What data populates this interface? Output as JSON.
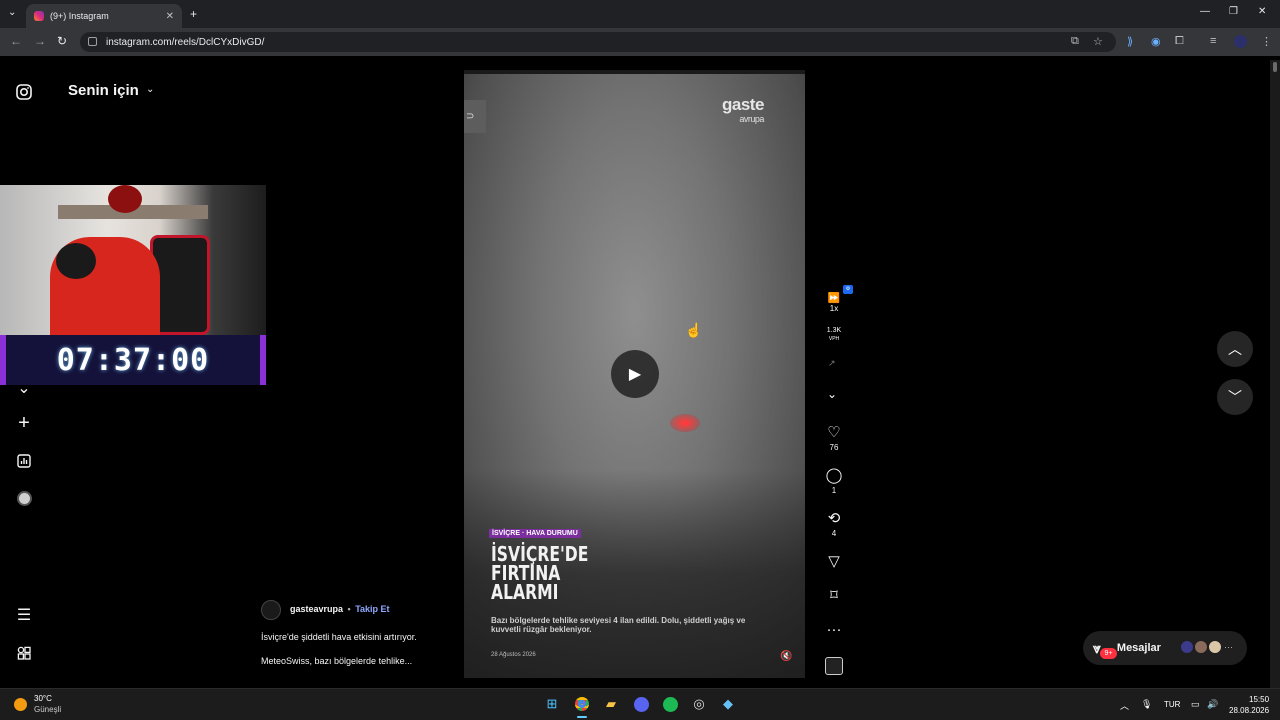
{
  "browser": {
    "tab_title": "(9+) Instagram",
    "url": "instagram.com/reels/DclCYxDivGD/",
    "new_tab_symbol": "+",
    "tab_close_symbol": "✕"
  },
  "feed": {
    "title": "Senin için"
  },
  "overlay": {
    "timer": "07:37:00"
  },
  "reel": {
    "watermark_brand": "gaste",
    "watermark_sub": "avrupa",
    "tag": "İSVİÇRE · HAVA DURUMU",
    "headline": "İSVİÇRE'DE FIRTINA ALARMI",
    "subline": "Bazı bölgelerde tehlike seviyesi 4 ilan edildi. Dolu, şiddetli yağış ve kuvvetli rüzgâr bekleniyor.",
    "date": "28 Ağustos 2026"
  },
  "actions": {
    "speed": "1x",
    "vph_count": "1.3K",
    "vph_label": "VPH",
    "likes": "76",
    "comments": "1",
    "reposts": "4"
  },
  "author": {
    "username": "gasteavrupa",
    "separator": "•",
    "follow_label": "Takip Et",
    "caption_line1": "İsviçre'de şiddetli hava etkisini artırıyor.",
    "caption_line2": "MeteoSwiss, bazı bölgelerde tehlike..."
  },
  "messages": {
    "label": "Mesajlar",
    "badge": "9+",
    "more": "···"
  },
  "taskbar": {
    "temperature": "30°C",
    "condition": "Güneşli",
    "language": "TUR",
    "time": "15:50",
    "date": "28.08.2026"
  },
  "colors": {
    "accent_blue": "#8fa8ff",
    "badge_red": "#ff3040",
    "tag_purple": "#7b2f9e"
  }
}
